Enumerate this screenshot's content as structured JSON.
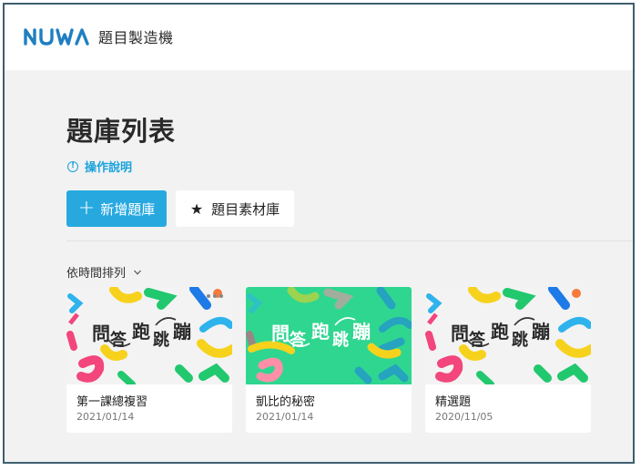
{
  "header": {
    "logo_text": "NUWA",
    "app_name": "題目製造機"
  },
  "page": {
    "title": "題庫列表",
    "help_link": "操作說明"
  },
  "actions": {
    "add_bank_label": "新增題庫",
    "materials_label": "題目素材庫"
  },
  "sort": {
    "label": "依時間排列"
  },
  "thumbnail": {
    "title_chars": [
      "問",
      "答",
      "跑",
      "跳",
      "蹦"
    ]
  },
  "cards": [
    {
      "name": "第一課總複習",
      "date": "2021/01/14",
      "theme": "light"
    },
    {
      "name": "凱比的秘密",
      "date": "2021/01/14",
      "theme": "green"
    },
    {
      "name": "精選題",
      "date": "2020/11/05",
      "theme": "light"
    }
  ],
  "colors": {
    "accent": "#27a9e0",
    "link": "#1aa3dc",
    "logo": "#1f7fc1",
    "page_bg": "#f2f2f2",
    "thumb_green": "#2fd690"
  }
}
